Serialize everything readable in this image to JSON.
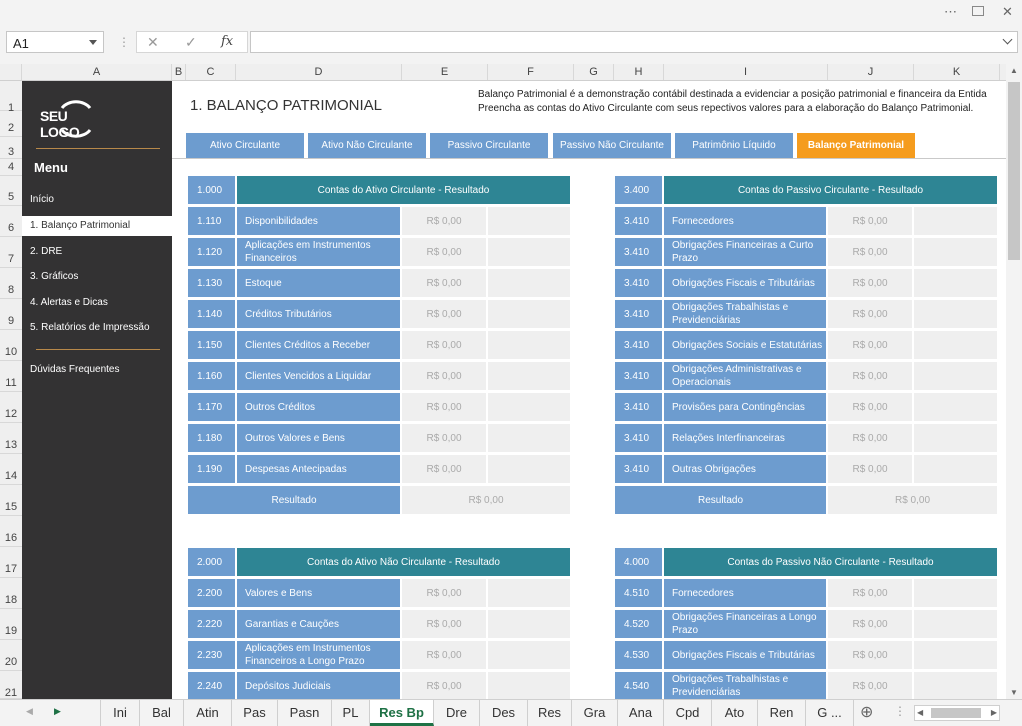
{
  "window": {
    "more_icon": "⋯",
    "restore_icon": "restore",
    "close_icon": "✕"
  },
  "formula_bar": {
    "name_box": "A1",
    "cancel_icon": "✕",
    "enter_icon": "✓",
    "fx_label": "fx",
    "formula": ""
  },
  "columns": [
    "A",
    "B",
    "C",
    "D",
    "E",
    "F",
    "G",
    "H",
    "I",
    "J",
    "K"
  ],
  "rows": [
    "1",
    "2",
    "3",
    "4",
    "5",
    "6",
    "7",
    "8",
    "9",
    "10",
    "11",
    "12",
    "13",
    "14",
    "15",
    "16",
    "17",
    "18",
    "19",
    "20",
    "21"
  ],
  "sidebar": {
    "logo": "SEU LOGO",
    "menu_title": "Menu",
    "items": [
      "Início",
      "1. Balanço Patrimonial",
      "2. DRE",
      "3. Gráficos",
      "4. Alertas e Dicas",
      "5. Relatórios de Impressão"
    ],
    "faq": "Dúvidas Frequentes"
  },
  "page": {
    "title": "1. BALANÇO PATRIMONIAL",
    "desc1": "Balanço Patrimonial é a demonstração contábil destinada a evidenciar a posição patrimonial e financeira da Entida",
    "desc2": "Preencha as contas do Ativo Circulante com seus repectivos valores para a elaboração do Balanço Patrimonial."
  },
  "tabs": [
    "Ativo Circulante",
    "Ativo Não Circulante",
    "Passivo Circulante",
    "Passivo Não Circulante",
    "Patrimônio Líquido",
    "Balanço Patrimonial"
  ],
  "tables": {
    "ac": {
      "code": "1.000",
      "title": "Contas do Ativo Circulante - Resultado",
      "rows": [
        [
          "1.110",
          "Disponibilidades",
          "R$ 0,00"
        ],
        [
          "1.120",
          "Aplicações em Instrumentos Financeiros",
          "R$ 0,00"
        ],
        [
          "1.130",
          "Estoque",
          "R$ 0,00"
        ],
        [
          "1.140",
          "Créditos Tributários",
          "R$ 0,00"
        ],
        [
          "1.150",
          "Clientes Créditos a Receber",
          "R$ 0,00"
        ],
        [
          "1.160",
          "Clientes Vencidos a Liquidar",
          "R$ 0,00"
        ],
        [
          "1.170",
          "Outros Créditos",
          "R$ 0,00"
        ],
        [
          "1.180",
          "Outros Valores e Bens",
          "R$ 0,00"
        ],
        [
          "1.190",
          "Despesas Antecipadas",
          "R$ 0,00"
        ]
      ],
      "result_label": "Resultado",
      "result_value": "R$ 0,00"
    },
    "pc": {
      "code": "3.400",
      "title": "Contas do Passivo Circulante - Resultado",
      "rows": [
        [
          "3.410",
          "Fornecedores",
          "R$ 0,00"
        ],
        [
          "3.410",
          "Obrigações Financeiras a Curto Prazo",
          "R$ 0,00"
        ],
        [
          "3.410",
          "Obrigações Fiscais e Tributárias",
          "R$ 0,00"
        ],
        [
          "3.410",
          "Obrigações Trabalhistas e Previdenciárias",
          "R$ 0,00"
        ],
        [
          "3.410",
          "Obrigações Sociais e Estatutárias",
          "R$ 0,00"
        ],
        [
          "3.410",
          "Obrigações Administrativas e Operacionais",
          "R$ 0,00"
        ],
        [
          "3.410",
          "Provisões para Contingências",
          "R$ 0,00"
        ],
        [
          "3.410",
          "Relações Interfinanceiras",
          "R$ 0,00"
        ],
        [
          "3.410",
          "Outras Obrigações",
          "R$ 0,00"
        ]
      ],
      "result_label": "Resultado",
      "result_value": "R$ 0,00"
    },
    "anc": {
      "code": "2.000",
      "title": "Contas do Ativo Não Circulante - Resultado",
      "rows": [
        [
          "2.200",
          "Valores e Bens",
          "R$ 0,00"
        ],
        [
          "2.220",
          "Garantias e Cauções",
          "R$ 0,00"
        ],
        [
          "2.230",
          "Aplicações em Instrumentos Financeiros a Longo Prazo",
          "R$ 0,00"
        ],
        [
          "2.240",
          "Depósitos Judiciais",
          "R$ 0,00"
        ]
      ]
    },
    "pnc": {
      "code": "4.000",
      "title": "Contas do Passivo Não Circulante - Resultado",
      "rows": [
        [
          "4.510",
          "Fornecedores",
          "R$ 0,00"
        ],
        [
          "4.520",
          "Obrigações Financeiras a Longo Prazo",
          "R$ 0,00"
        ],
        [
          "4.530",
          "Obrigações Fiscais e Tributárias",
          "R$ 0,00"
        ],
        [
          "4.540",
          "Obrigações Trabalhistas e Previdenciárias",
          "R$ 0,00"
        ]
      ]
    }
  },
  "sheet_tabs": [
    "Ini",
    "Bal",
    "Atin",
    "Pas",
    "Pasn",
    "PL",
    "Res Bp",
    "Dre",
    "Des",
    "Res",
    "Gra",
    "Ana",
    "Cpd",
    "Ato",
    "Ren",
    "G ..."
  ],
  "active_sheet": "Res Bp",
  "icons": {
    "prev": "◀",
    "next": "▶",
    "add": "⊕"
  }
}
